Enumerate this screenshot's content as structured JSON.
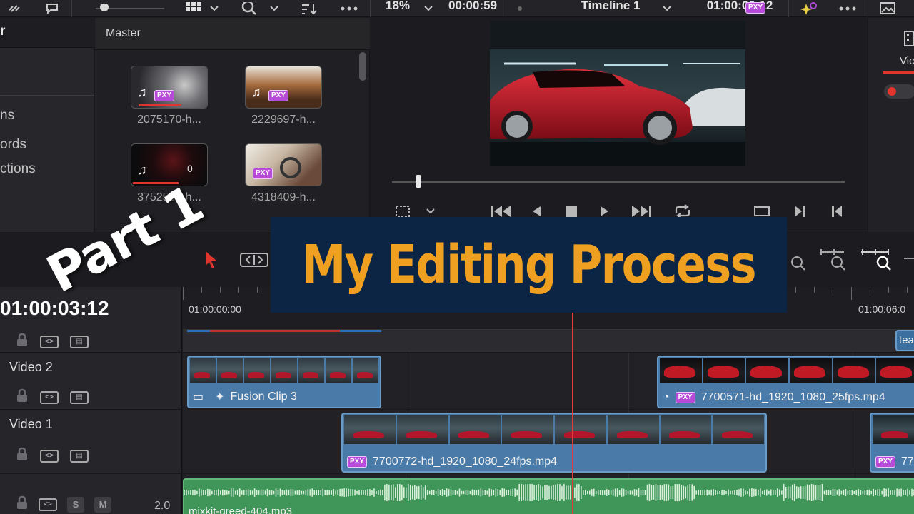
{
  "toolbar": {
    "zoom": "18%",
    "timecode_left": "00:00:59",
    "timeline_name": "Timeline 1",
    "timecode_right": "01:00:06:12",
    "proxy_badge": "PXY"
  },
  "bins": {
    "items": [
      "r",
      "ns",
      "ords",
      "ctions"
    ]
  },
  "media_pool": {
    "title": "Master",
    "clips": [
      {
        "label": "2075170-h...",
        "badge": "PXY",
        "audio": true
      },
      {
        "label": "2229697-h...",
        "badge": "PXY",
        "audio": true
      },
      {
        "label": "3752531-h...",
        "badge": "",
        "audio": true
      },
      {
        "label": "4318409-h...",
        "badge": "PXY",
        "audio": false
      }
    ]
  },
  "inspector": {
    "tab_label": "Vic"
  },
  "timeline": {
    "current_timecode": "01:00:03:12",
    "ruler_labels": [
      "01:00:00:00",
      "01:00:06:0"
    ],
    "tracks": {
      "video2": {
        "name": "Video 2"
      },
      "video1": {
        "name": "Video 1"
      },
      "audio1": {
        "s_label": "S",
        "m_label": "M",
        "level": "2.0"
      }
    },
    "clips": {
      "fusion": "Fusion Clip 3",
      "v2_clip": "7700571-hd_1920_1080_25fps.mp4",
      "v1_clip": "7700772-hd_1920_1080_24fps.mp4",
      "v1_clip_right": "77",
      "top_clip": "tea",
      "audio": "mixkit-greed-404.mp3",
      "pxy": "PXY"
    }
  },
  "overlay": {
    "title": "My Editing Process",
    "part": "Part 1"
  },
  "colors": {
    "accent_title": "#f0a021",
    "banner_bg": "#0d2545",
    "clip_blue": "#4a7ba8",
    "audio_green": "#3f9658",
    "playhead": "#e33b3b",
    "proxy_purple": "#b64bd8"
  }
}
